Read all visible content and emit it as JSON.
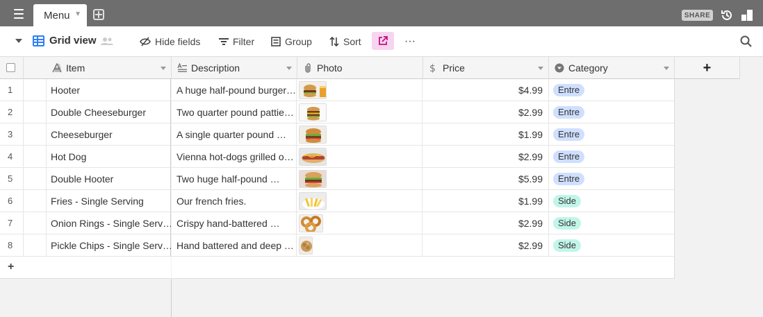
{
  "tab": {
    "name": "Menu"
  },
  "topbar": {
    "share_label": "SHARE"
  },
  "viewbar": {
    "view_name": "Grid view",
    "hide_fields": "Hide fields",
    "filter": "Filter",
    "group": "Group",
    "sort": "Sort",
    "more": "···"
  },
  "columns": {
    "item": "Item",
    "description": "Description",
    "photo": "Photo",
    "price": "Price",
    "category": "Category"
  },
  "rows": [
    {
      "num": "1",
      "item": "Hooter",
      "description": "A huge half-pound burger…",
      "price": "$4.99",
      "category": "Entre",
      "thumb": "burger-fries"
    },
    {
      "num": "2",
      "item": "Double Cheeseburger",
      "description": "Two quarter pound pattie…",
      "price": "$2.99",
      "category": "Entre",
      "thumb": "double-burger"
    },
    {
      "num": "3",
      "item": "Cheeseburger",
      "description": "A single quarter pound …",
      "price": "$1.99",
      "category": "Entre",
      "thumb": "burger"
    },
    {
      "num": "4",
      "item": "Hot Dog",
      "description": "Vienna hot-dogs grilled o…",
      "price": "$2.99",
      "category": "Entre",
      "thumb": "hot-dog"
    },
    {
      "num": "5",
      "item": "Double Hooter",
      "description": "Two huge half-pound …",
      "price": "$5.99",
      "category": "Entre",
      "thumb": "big-burger"
    },
    {
      "num": "6",
      "item": "Fries - Single Serving",
      "description": "Our french fries.",
      "price": "$1.99",
      "category": "Side",
      "thumb": "fries"
    },
    {
      "num": "7",
      "item": "Onion Rings - Single Serv…",
      "description": "Crispy hand-battered …",
      "price": "$2.99",
      "category": "Side",
      "thumb": "onion-rings"
    },
    {
      "num": "8",
      "item": "Pickle Chips - Single Serv…",
      "description": "Hand battered and deep …",
      "price": "$2.99",
      "category": "Side",
      "thumb": "pickle-chips"
    }
  ],
  "add_row_label": "+",
  "add_field_label": "+",
  "colors": {
    "topbar": "#6e6e6e",
    "accent": "#2d7ff9",
    "entre_badge": "#cfdfff",
    "side_badge": "#c2f5e9",
    "extension_button": "#f7d4f0"
  }
}
